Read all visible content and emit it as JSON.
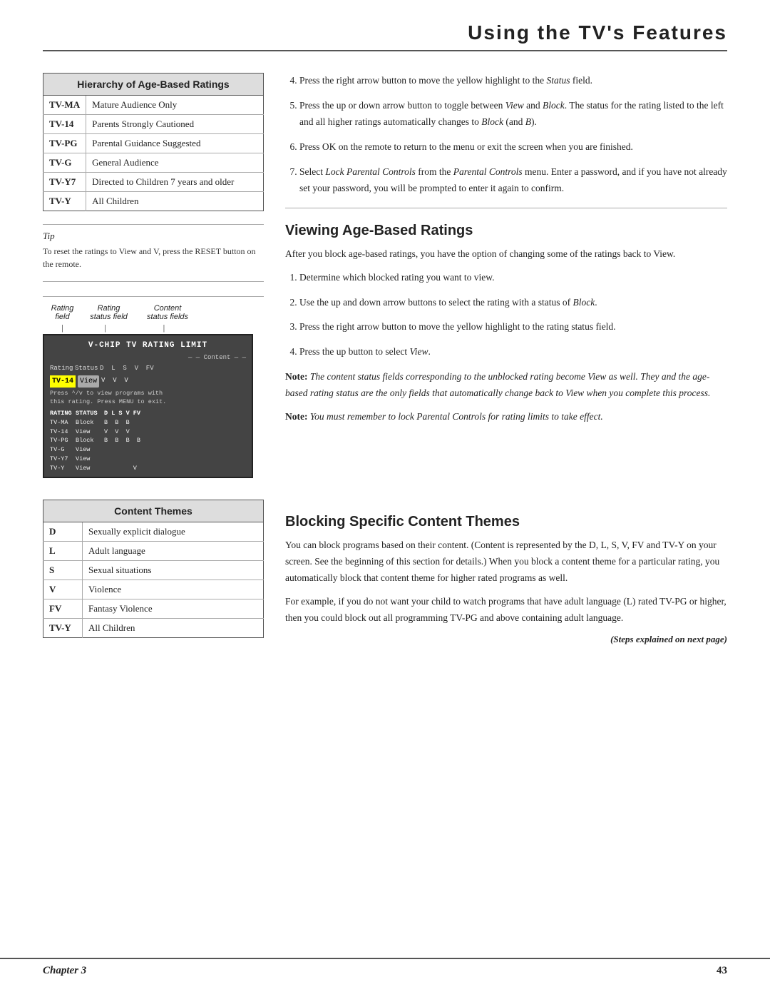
{
  "header": {
    "title": "Using the TV's Features"
  },
  "left_table": {
    "heading": "Hierarchy of Age-Based Ratings",
    "rows": [
      {
        "code": "TV-MA",
        "description": "Mature Audience Only"
      },
      {
        "code": "TV-14",
        "description": "Parents Strongly Cautioned"
      },
      {
        "code": "TV-PG",
        "description": "Parental Guidance Suggested"
      },
      {
        "code": "TV-G",
        "description": "General Audience"
      },
      {
        "code": "TV-Y7",
        "description": "Directed to Children 7 years and older"
      },
      {
        "code": "TV-Y",
        "description": "All Children"
      }
    ]
  },
  "tip": {
    "title": "Tip",
    "text": "To reset the ratings to View and V, press the RESET button on the remote."
  },
  "diagram": {
    "label1": "Rating\nfield",
    "label2": "Rating\nstatus field",
    "label3": "Content\nstatus fields",
    "tv_title": "V-CHIP TV RATING LIMIT",
    "tv_header": "— — Content — —",
    "tv_cols": "Rating  Status  D  L  S  V  FV",
    "tv_selected_rating": "TV-14",
    "tv_selected_status": "View",
    "tv_v_vals": "V  V  V",
    "tv_hint": "Press ^/v to view programs with\nthis rating. Press MENU to exit.",
    "tv_data": [
      {
        "rating": "RATING",
        "status": "STATUS",
        "cols": "D  L  S  V  FV"
      },
      {
        "rating": "TV-MA",
        "status": "Block",
        "cols": "B  B  B"
      },
      {
        "rating": "TV-14",
        "status": "View",
        "cols": "V  V  V"
      },
      {
        "rating": "TV-PG",
        "status": "Block",
        "cols": "B  B  B  B"
      },
      {
        "rating": "TV-G",
        "status": "View",
        "cols": ""
      },
      {
        "rating": "TV-Y7",
        "status": "View",
        "cols": ""
      },
      {
        "rating": "TV-Y",
        "status": "View",
        "cols": "V"
      }
    ]
  },
  "right_steps_top": [
    "Press the right arrow button to move the yellow highlight to the Status field.",
    "Press the up or down arrow button to toggle between View and Block. The status for the rating listed to the left and all higher ratings automatically changes to Block (and B).",
    "Press OK on the remote to return to the menu or exit the screen when you are finished.",
    "Select Lock Parental Controls from the Parental Controls menu. Enter a password, and if you have not already set your password, you will be prompted to enter it again to confirm."
  ],
  "viewing_section": {
    "heading": "Viewing Age-Based Ratings",
    "intro": "After you block age-based ratings, you have the option of changing some of the ratings back to View.",
    "steps": [
      "Determine which blocked rating you want to view.",
      "Use the up and down arrow buttons to select the rating with a status of Block.",
      "Press the right arrow button to move the yellow highlight to the rating status field.",
      "Press the up button to select View."
    ],
    "note1": "Note: The content status fields corresponding to the unblocked rating become View as well. They and the age-based rating status are the only fields that automatically change back to View when you complete this process.",
    "note2": "Note: You must remember to lock Parental Controls for rating limits to take effect."
  },
  "content_themes_table": {
    "heading": "Content Themes",
    "rows": [
      {
        "code": "D",
        "description": "Sexually explicit dialogue"
      },
      {
        "code": "L",
        "description": "Adult language"
      },
      {
        "code": "S",
        "description": "Sexual situations"
      },
      {
        "code": "V",
        "description": "Violence"
      },
      {
        "code": "FV",
        "description": "Fantasy Violence"
      },
      {
        "code": "TV-Y",
        "description": "All Children"
      }
    ]
  },
  "blocking_section": {
    "heading": "Blocking Specific Content Themes",
    "para1": "You can block programs based on their content. (Content is represented by the D, L, S, V, FV and TV-Y on your screen. See the beginning of this section for details.) When you block a content theme for a particular rating, you automatically block that content theme for higher rated programs as well.",
    "para2": "For example, if you do not want your child to watch programs that have adult language (L) rated TV-PG or higher, then you could block out all programming TV-PG and above containing adult language.",
    "steps_note": "(Steps explained on next page)"
  },
  "footer": {
    "chapter": "Chapter 3",
    "page": "43"
  }
}
